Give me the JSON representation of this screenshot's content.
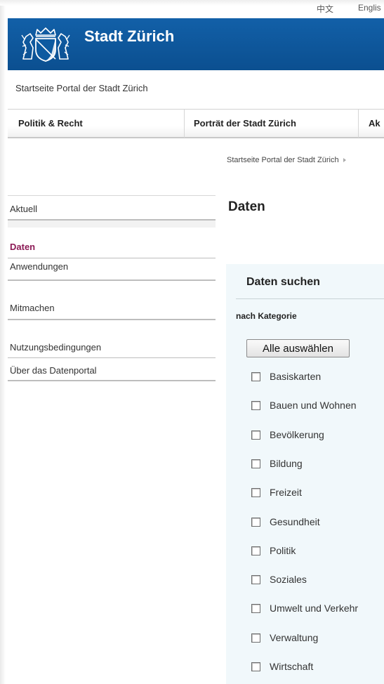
{
  "language_bar": {
    "chinese": "中文",
    "english": "Englis"
  },
  "header": {
    "title": "Stadt Zürich"
  },
  "portal_home": "Startseite Portal der Stadt Zürich",
  "main_nav": {
    "items": [
      {
        "label": "Politik & Recht"
      },
      {
        "label": "Porträt der Stadt Zürich"
      },
      {
        "label": "Ak"
      }
    ]
  },
  "breadcrumb": {
    "home": "Startseite Portal der Stadt Zürich"
  },
  "sidebar": {
    "items": [
      {
        "label": "Aktuell"
      },
      {
        "label": "Daten"
      },
      {
        "label": "Anwendungen"
      },
      {
        "label": "Mitmachen"
      },
      {
        "label": "Nutzungsbedingungen"
      },
      {
        "label": "Über das Datenportal"
      }
    ],
    "active_color": "#8c1a55"
  },
  "page_title": "Daten",
  "search": {
    "title": "Daten suchen",
    "category_heading": "nach Kategorie",
    "select_all": "Alle auswählen",
    "categories": [
      {
        "label": "Basiskarten"
      },
      {
        "label": "Bauen und Wohnen"
      },
      {
        "label": "Bevölkerung"
      },
      {
        "label": "Bildung"
      },
      {
        "label": "Freizeit"
      },
      {
        "label": "Gesundheit"
      },
      {
        "label": "Politik"
      },
      {
        "label": "Soziales"
      },
      {
        "label": "Umwelt und Verkehr"
      },
      {
        "label": "Verwaltung"
      },
      {
        "label": "Wirtschaft"
      }
    ]
  },
  "colors": {
    "header_blue": "#0d5aa0",
    "panel_bg": "#f1f8fb"
  }
}
